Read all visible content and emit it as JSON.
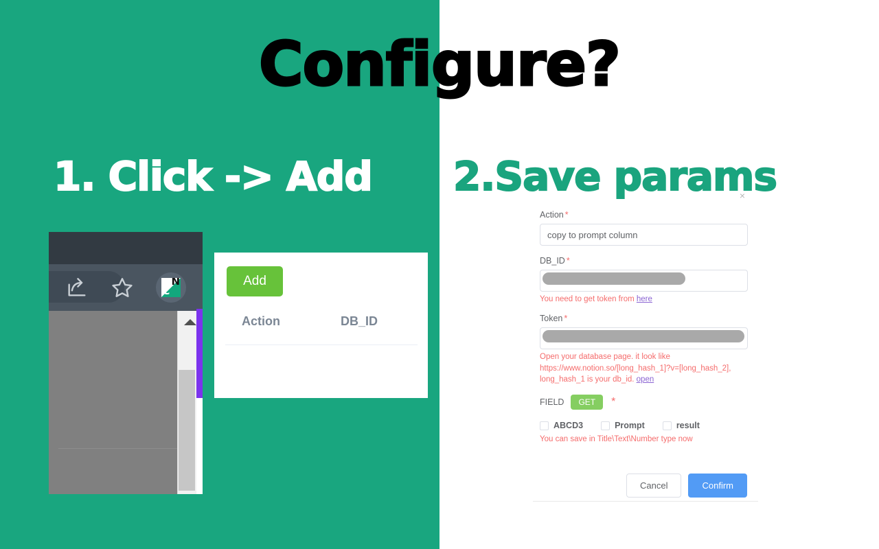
{
  "slide": {
    "title": "Configure?",
    "background_green": "#19a67f",
    "background_white": "#ffffff",
    "step1_heading": "1. Click -> Add",
    "step2_heading": "2.Save params"
  },
  "browser_screenshot": {
    "toolbar_icons": [
      {
        "name": "share-icon",
        "label": "Share"
      },
      {
        "name": "star-icon",
        "label": "Bookmark"
      }
    ],
    "extension_icon": {
      "name": "notion-extension-icon",
      "letter_top": "N",
      "letter_bottom": "C",
      "green": "#12a87d"
    },
    "scrollbar": {
      "up_arrow": "▲",
      "accent_strip_color": "#7b33ed"
    }
  },
  "popup": {
    "add_label": "Add",
    "add_color": "#67c23a",
    "columns": [
      "Action",
      "DB_ID"
    ]
  },
  "form": {
    "close_label": "×",
    "action": {
      "label": "Action",
      "required": "*",
      "value": "copy to prompt column",
      "placeholder": "copy to prompt column"
    },
    "db_id": {
      "label": "DB_ID",
      "required": "*",
      "value": "",
      "placeholder": "",
      "help_prefix": "You need to get token from ",
      "help_link": "here"
    },
    "token": {
      "label": "Token",
      "required": "*",
      "value": "",
      "placeholder": "",
      "help_line1": "Open your database page. it look like",
      "help_line2": "https://www.notion.so/[long_hash_1]?v=[long_hash_2],",
      "help_line3_prefix": "long_hash_1 is your db_id. ",
      "help_link": "open"
    },
    "field": {
      "label": "FIELD",
      "get_label": "GET",
      "required": "*",
      "get_color": "#85ce61",
      "checkboxes": [
        {
          "label": "ABCD3",
          "checked": false
        },
        {
          "label": "Prompt",
          "checked": false
        },
        {
          "label": "result",
          "checked": false
        }
      ],
      "help": "You can save in Title\\Text\\Number type now"
    },
    "buttons": {
      "cancel": "Cancel",
      "confirm": "Confirm",
      "confirm_color": "#529bf5"
    }
  }
}
